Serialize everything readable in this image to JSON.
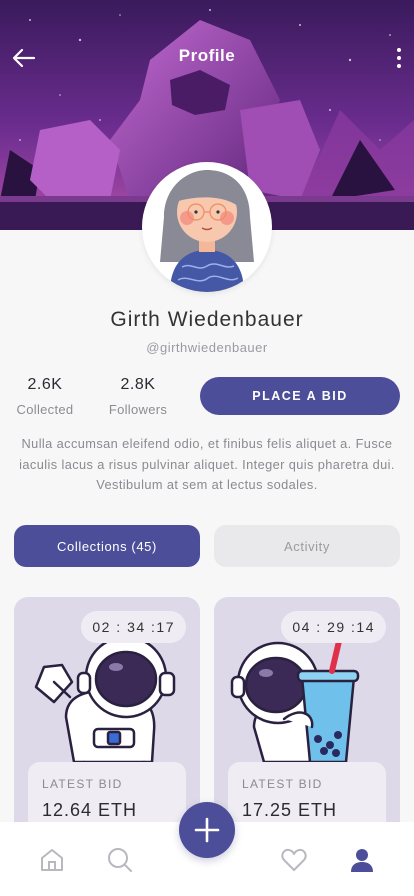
{
  "header": {
    "title": "Profile",
    "back_icon": "arrow-left-icon",
    "menu_icon": "more-vertical-icon"
  },
  "profile": {
    "name": "Girth Wiedenbauer",
    "handle": "@girthwiedenbauer",
    "stats": [
      {
        "value": "2.6K",
        "label": "Collected"
      },
      {
        "value": "2.8K",
        "label": "Followers"
      }
    ],
    "place_bid_label": "PLACE A BID",
    "bio": "Nulla accumsan eleifend odio, et finibus felis aliquet a. Fusce iaculis lacus a risus pulvinar aliquet. Integer quis pharetra dui. Vestibulum at sem at lectus sodales."
  },
  "tabs": [
    {
      "label": "Collections (45)",
      "active": true
    },
    {
      "label": "Activity",
      "active": false
    }
  ],
  "cards": [
    {
      "timer": "02 : 34 :17",
      "bid_label": "LATEST BID",
      "bid_value": "12.64 ETH",
      "art": "astronaut-waving"
    },
    {
      "timer": "04 : 29 :14",
      "bid_label": "LATEST BID",
      "bid_value": "17.25 ETH",
      "art": "astronaut-boba-tea"
    }
  ],
  "nav": {
    "items": [
      "home-icon",
      "search-icon",
      "add-icon",
      "heart-icon",
      "user-icon"
    ],
    "active": "user-icon"
  },
  "colors": {
    "accent": "#4c4e9a",
    "banner": "#6a2a8a"
  }
}
